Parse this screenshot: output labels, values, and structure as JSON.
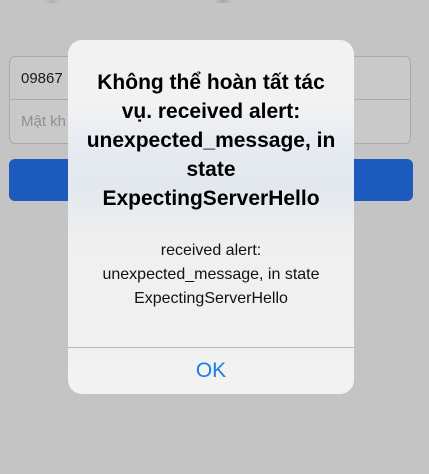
{
  "login_form": {
    "phone_value": "09867",
    "password_placeholder": "Mật kh"
  },
  "alert": {
    "title": "Không thể hoàn tất tác vụ. received alert: unexpected_message, in state ExpectingServerHello",
    "message": "received alert: unexpected_message, in state ExpectingServerHello",
    "ok_label": "OK"
  },
  "colors": {
    "background": "#c4c4c4",
    "login_button": "#1c5bbd",
    "alert_button_text": "#1a7ee8"
  }
}
